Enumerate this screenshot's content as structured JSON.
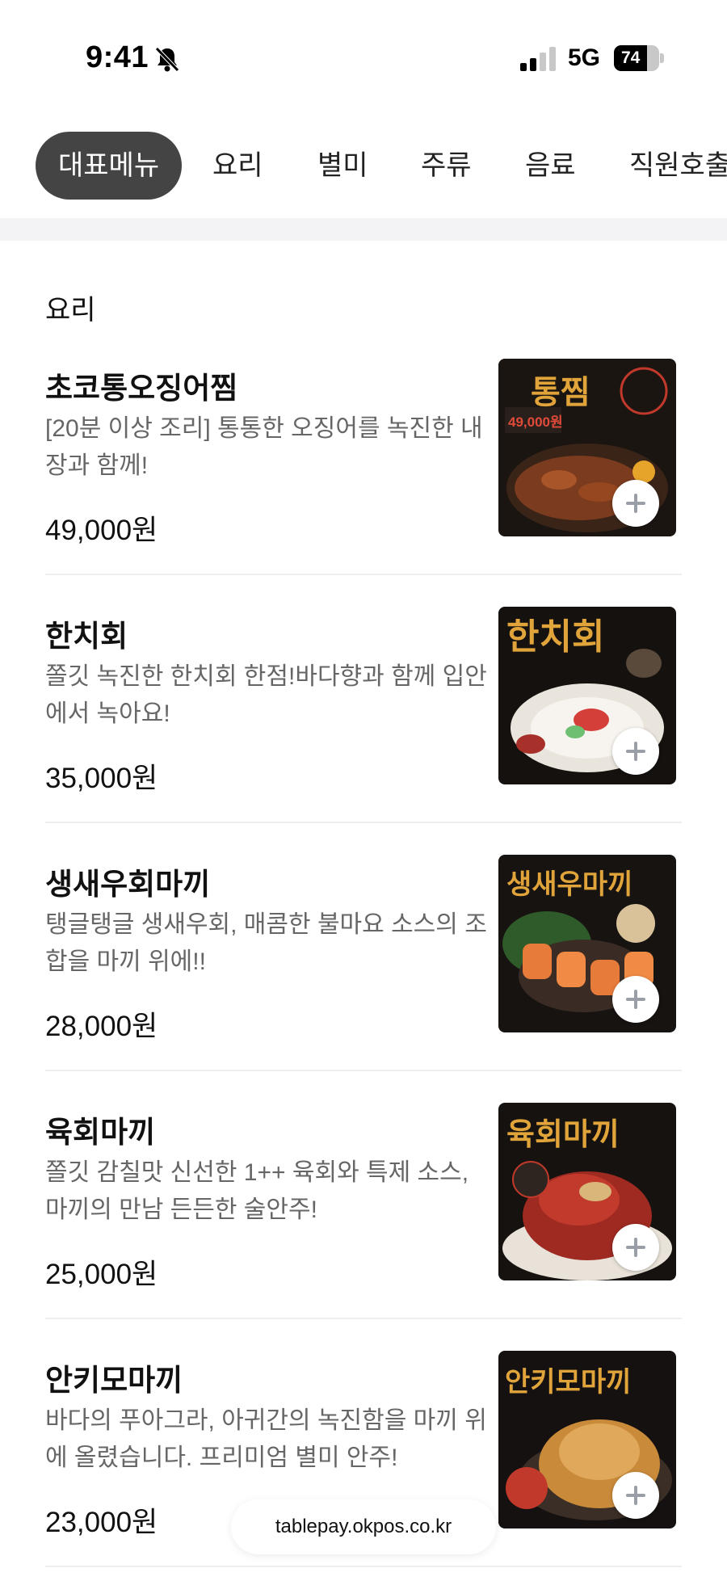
{
  "status_bar": {
    "time": "9:41",
    "network": "5G",
    "battery": "74",
    "battery_level": 0.74,
    "icons": [
      "bell-slash-icon",
      "signal-icon",
      "battery-icon"
    ]
  },
  "tabs": [
    {
      "label": "대표메뉴",
      "active": true
    },
    {
      "label": "요리",
      "active": false
    },
    {
      "label": "별미",
      "active": false
    },
    {
      "label": "주류",
      "active": false
    },
    {
      "label": "음료",
      "active": false
    },
    {
      "label": "직원호출",
      "active": false
    }
  ],
  "section": {
    "title": "요리",
    "items": [
      {
        "name": "초코통오징어찜",
        "description": "[20분 이상 조리] 통통한 오징어를 녹진한 내장과 함께!",
        "price": "49,000원",
        "image_text": "통찜",
        "image_badge": "49,000원"
      },
      {
        "name": "한치회",
        "description": "쫄깃 녹진한 한치회 한점!바다향과 함께 입안에서 녹아요!",
        "price": "35,000원",
        "image_text": "한치회"
      },
      {
        "name": "생새우회마끼",
        "description": "탱글탱글 생새우회, 매콤한 불마요 소스의 조합을 마끼 위에!!",
        "price": "28,000원",
        "image_text": "생새우마끼"
      },
      {
        "name": "육회마끼",
        "description": "쫄깃 감칠맛 신선한 1++ 육회와 특제 소스, 마끼의 만남 든든한 술안주!",
        "price": "25,000원",
        "image_text": "육회마끼"
      },
      {
        "name": "안키모마끼",
        "description": "바다의 푸아그라, 아귀간의 녹진함을 마끼 위에 올렸습니다. 프리미엄 별미 안주!",
        "price": "23,000원",
        "image_text": "안키모마끼"
      }
    ]
  },
  "url_bar": {
    "text": "tablepay.okpos.co.kr"
  },
  "colors": {
    "active_tab": "#444444",
    "image_text": "#e0a43a",
    "background": "#ffffff"
  }
}
